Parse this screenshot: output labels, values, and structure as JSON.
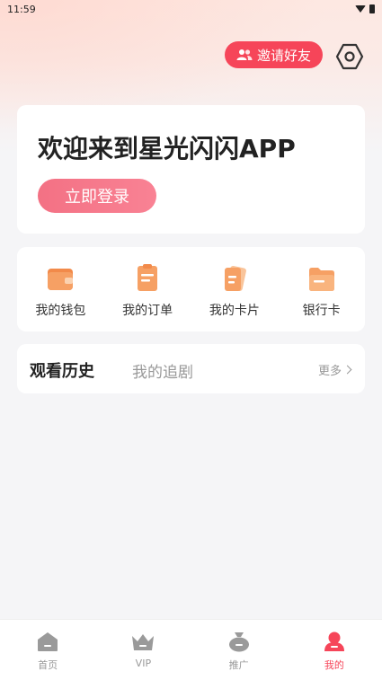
{
  "status_bar": {
    "time": "11:59"
  },
  "header": {
    "invite_label": "邀请好友",
    "icons": [
      "invite-users-icon",
      "settings-hexagon-icon"
    ]
  },
  "welcome": {
    "title": "欢迎来到星光闪闪APP",
    "login_label": "立即登录"
  },
  "menu": {
    "items": [
      {
        "label": "我的钱包",
        "icon": "wallet-icon"
      },
      {
        "label": "我的订单",
        "icon": "order-icon"
      },
      {
        "label": "我的卡片",
        "icon": "card-icon"
      },
      {
        "label": "银行卡",
        "icon": "bank-card-icon"
      }
    ]
  },
  "history": {
    "tabs": [
      "观看历史",
      "我的追剧"
    ],
    "more_label": "更多"
  },
  "tabbar": {
    "items": [
      {
        "label": "首页",
        "icon": "home-icon"
      },
      {
        "label": "VIP",
        "icon": "crown-icon"
      },
      {
        "label": "推广",
        "icon": "money-bag-icon"
      },
      {
        "label": "我的",
        "icon": "profile-icon"
      }
    ],
    "active": "我的"
  },
  "colors": {
    "accent": "#f64559",
    "login_button": "#f37184",
    "icon_orange": "#f5a05c",
    "background": "#f5f5f7"
  }
}
